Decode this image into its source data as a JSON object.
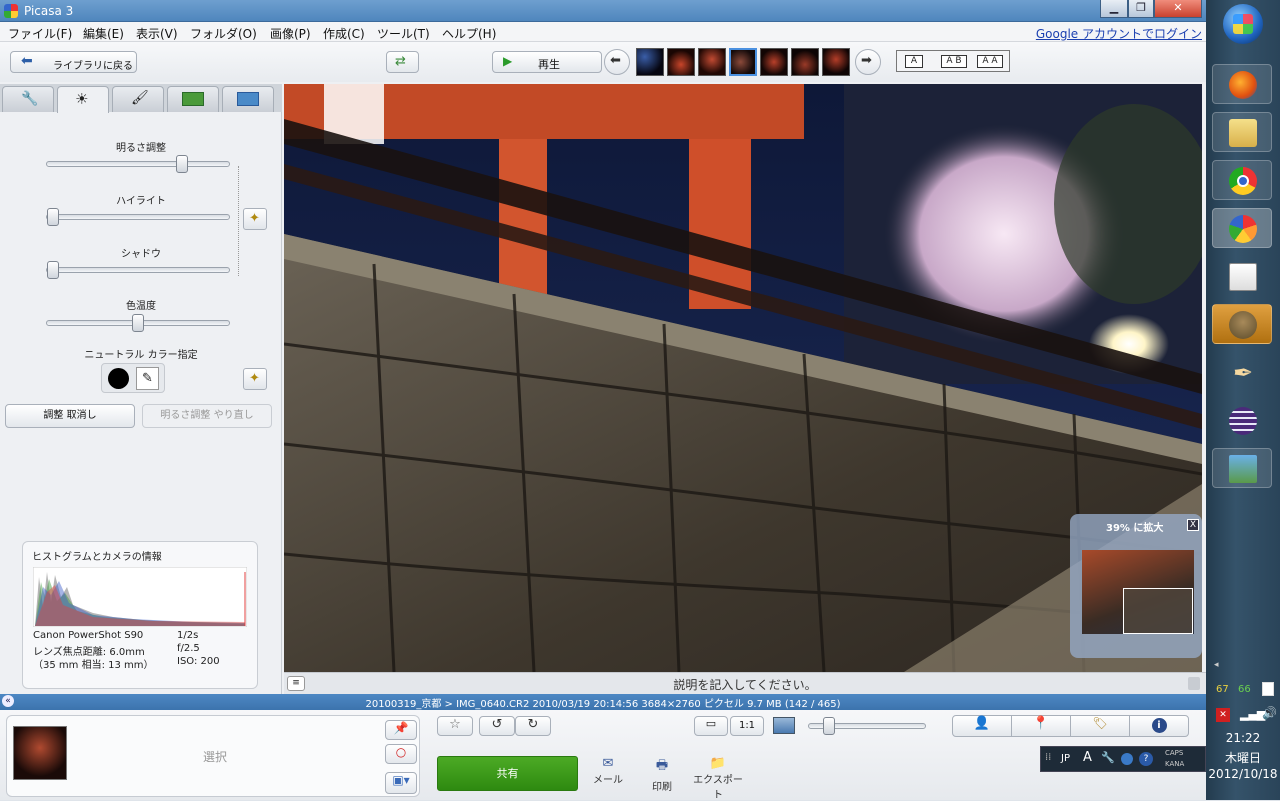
{
  "window": {
    "title": "Picasa 3"
  },
  "menubar": {
    "items": [
      "ファイル(F)",
      "編集(E)",
      "表示(V)",
      "フォルダ(O)",
      "画像(P)",
      "作成(C)",
      "ツール(T)",
      "ヘルプ(H)"
    ],
    "google_login": "Google アカウントでログイン"
  },
  "toolbar": {
    "back_label": "ライブラリに戻る",
    "play_label": "再生",
    "layout_single": "A",
    "layout_ab": "A B",
    "layout_aa": "A A"
  },
  "edit_panel": {
    "brightness_label": "明るさ調整",
    "highlight_label": "ハイライト",
    "shadow_label": "シャドウ",
    "color_temp_label": "色温度",
    "neutral_color_label": "ニュートラル カラー指定",
    "undo_label": "調整 取消し",
    "redo_label": "明るさ調整 やり直し",
    "brightness_value": 0.76,
    "highlight_value": 0.0,
    "shadow_value": 0.0,
    "color_temp_value": 0.5
  },
  "histogram": {
    "title": "ヒストグラムとカメラの情報",
    "camera": "Canon PowerShot S90",
    "shutter": "1/2s",
    "focal": "レンズ焦点距離: 6.0mm",
    "aperture": "f/2.5",
    "equiv": "（35 mm 相当:  13 mm）",
    "iso": "ISO: 200"
  },
  "zoom_overlay": {
    "label": "39% に拡大",
    "close": "X"
  },
  "caption": {
    "placeholder": "説明を記入してください。"
  },
  "infobar": {
    "text": "20100319_京都 > IMG_0640.CR2  2010/03/19 20:14:56  3684×2760 ピクセル  9.7 MB     (142 / 465)"
  },
  "bottom": {
    "select_label": "選択",
    "share_label": "共有",
    "mail_label": "メール",
    "print_label": "印刷",
    "export_label": "エクスポート",
    "zoom_11": "1:1"
  },
  "taskbar": {
    "num_a": "67",
    "num_b": "66",
    "ime_lang": "JP",
    "ime_a": "A",
    "caps": "CAPS",
    "kana": "KANA",
    "time": "21:22",
    "weekday": "木曜日",
    "date": "2012/10/18"
  }
}
